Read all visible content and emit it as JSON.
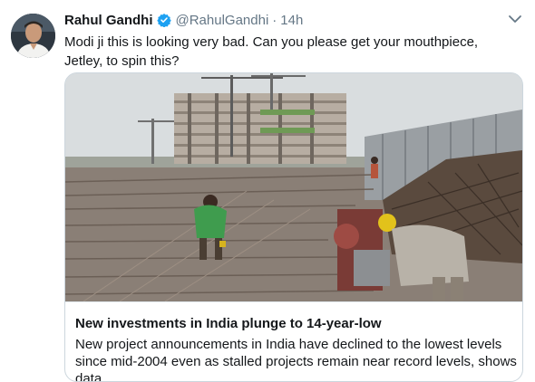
{
  "tweet": {
    "author_name": "Rahul Gandhi",
    "handle": "@RahulGandhi",
    "separator": "·",
    "time": "14h",
    "text": "Modi ji this is looking very bad. Can you please get your mouthpiece, Jetley, to spin this?",
    "verified_icon": "verified-badge-icon",
    "menu_icon": "chevron-down-icon"
  },
  "card": {
    "title": "New investments in India plunge to 14-year-low",
    "description": "New project announcements in India have declined to the lowest levels since mid-2004 even as stalled projects remain near record levels, shows data"
  },
  "colors": {
    "accent": "#1da1f2",
    "secondary_text": "#657786",
    "card_border": "#ccd6dd"
  }
}
